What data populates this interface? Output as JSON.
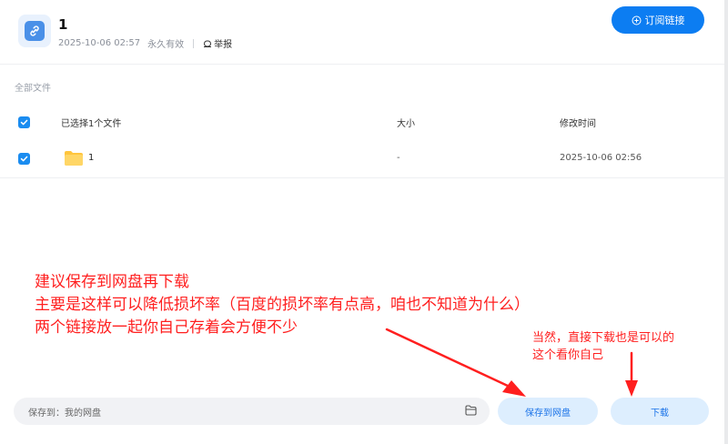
{
  "header": {
    "title": "1",
    "date": "2025-10-06 02:57",
    "validity": "永久有效",
    "report_label": "举报",
    "subscribe_label": "订阅链接"
  },
  "breadcrumb": "全部文件",
  "table": {
    "headers": {
      "name": "已选择1个文件",
      "size": "大小",
      "modified": "修改时间"
    },
    "rows": [
      {
        "name": "1",
        "size": "-",
        "modified": "2025-10-06 02:56",
        "checked": true
      }
    ]
  },
  "bottom": {
    "save_to_label": "保存到：我的网盘",
    "save_button": "保存到网盘",
    "download_button": "下载"
  },
  "annotations": {
    "main": [
      "建议保存到网盘再下载",
      "主要是这样可以降低损坏率（百度的损坏率有点高，咱也不知道为什么）",
      "两个链接放一起你自己存着会方便不少"
    ],
    "side": [
      "当然，直接下载也是可以的",
      "这个看你自己"
    ]
  },
  "colors": {
    "primary": "#0c7df2",
    "annotation": "#ff1f1f",
    "light_button": "#ddeefe"
  }
}
